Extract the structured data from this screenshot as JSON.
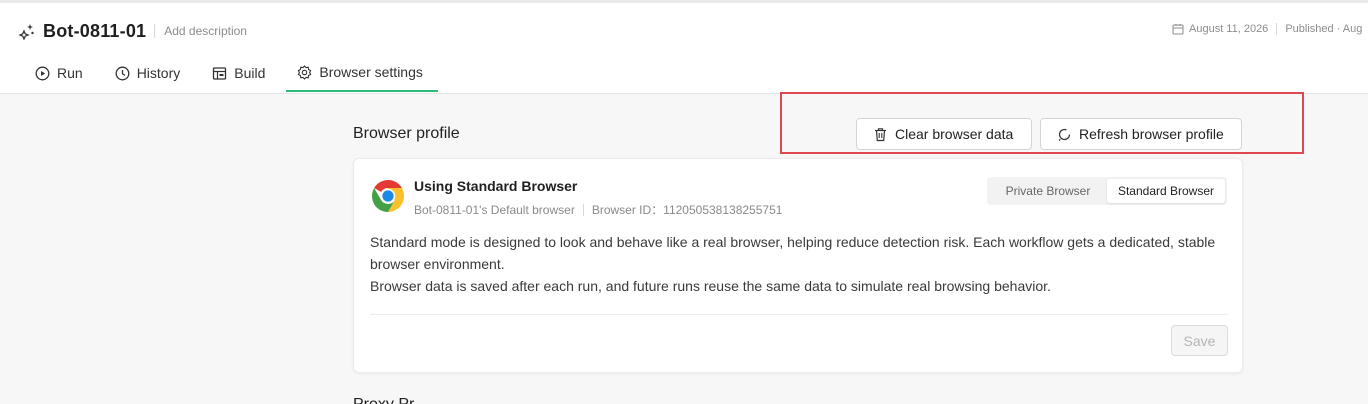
{
  "header": {
    "bot_name": "Bot-0811-01",
    "add_description": "Add description",
    "date": "August 11, 2026",
    "published": "Published · Aug"
  },
  "tabs": [
    {
      "label": "Run",
      "icon": "play-circle-icon"
    },
    {
      "label": "History",
      "icon": "clock-icon"
    },
    {
      "label": "Build",
      "icon": "layout-icon"
    },
    {
      "label": "Browser settings",
      "icon": "gear-icon",
      "active": true
    }
  ],
  "browser_profile": {
    "section_title": "Browser profile",
    "clear_button": "Clear browser data",
    "refresh_button": "Refresh browser profile"
  },
  "card": {
    "title": "Using Standard Browser",
    "default_browser": "Bot-0811-01's Default browser",
    "browser_id": "Browser ID：112050538138255751",
    "mode_options": [
      "Private Browser",
      "Standard Browser"
    ],
    "selected_mode": "Standard Browser",
    "description_line1": "Standard mode is designed to look and behave like a real browser, helping reduce detection risk. Each workflow gets a dedicated, stable browser environment.",
    "description_line2": "Browser data is saved after each run, and future runs reuse the same data to simulate real browsing behavior.",
    "save_label": "Save"
  },
  "next_section_title": "Proxy Pr",
  "colors": {
    "accent": "#2ebc7a",
    "highlight": "#e0484f"
  }
}
